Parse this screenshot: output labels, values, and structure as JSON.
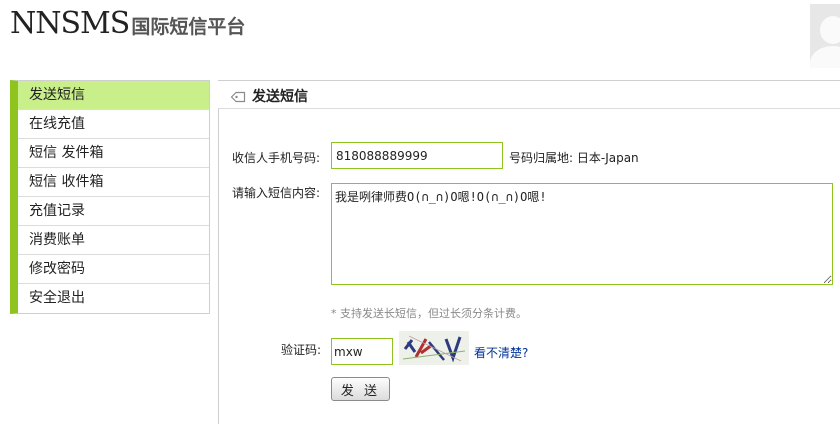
{
  "brand": {
    "name": "NNSMS",
    "subtitle": "国际短信平台"
  },
  "sidebar": {
    "items": [
      {
        "label": "发送短信"
      },
      {
        "label": "在线充值"
      },
      {
        "label": "短信 发件箱"
      },
      {
        "label": "短信 收件箱"
      },
      {
        "label": "充值记录"
      },
      {
        "label": "消费账单"
      },
      {
        "label": "修改密码"
      },
      {
        "label": "安全退出"
      }
    ],
    "active_index": 0,
    "accent_color": "#8fc31f",
    "active_bg": "#c8ef8a"
  },
  "panel": {
    "title": "发送短信",
    "icon": "tag-icon"
  },
  "form": {
    "phone_label": "收信人手机号码:",
    "phone_value": "818088889999",
    "location_text": "号码归属地: 日本-Japan",
    "message_label": "请输入短信内容:",
    "message_value": "我是咧律师费O(∩_∩)O嗯!O(∩_∩)O嗯!",
    "hint": "* 支持发送长短信，但过长须分条计费。",
    "captcha_label": "验证码:",
    "captcha_value": "mxw",
    "refresh_link": "看不清楚?",
    "send_button": "发 送"
  }
}
